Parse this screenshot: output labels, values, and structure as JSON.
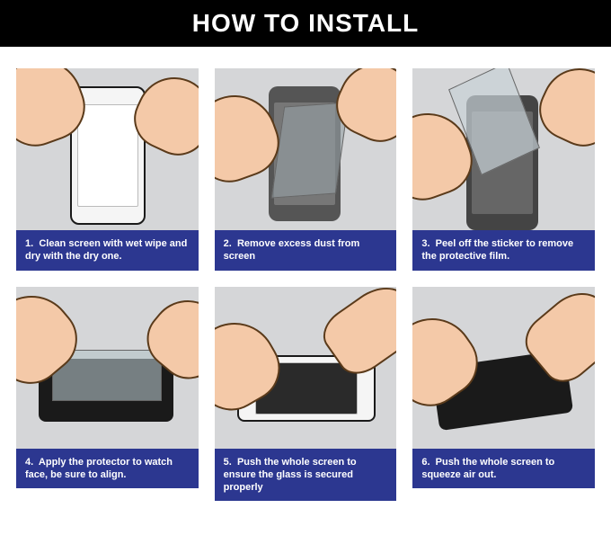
{
  "title": "HOW TO INSTALL",
  "steps": [
    {
      "num": "1.",
      "text": "Clean screen with wet wipe and dry with the dry one."
    },
    {
      "num": "2.",
      "text": "Remove excess dust from screen"
    },
    {
      "num": "3.",
      "text": "Peel off the sticker to remove the protective film."
    },
    {
      "num": "4.",
      "text": "Apply the protector to watch face, be sure to align."
    },
    {
      "num": "5.",
      "text": "Push the whole screen to ensure the glass is secured properly"
    },
    {
      "num": "6.",
      "text": "Push the whole screen to squeeze air out."
    }
  ]
}
